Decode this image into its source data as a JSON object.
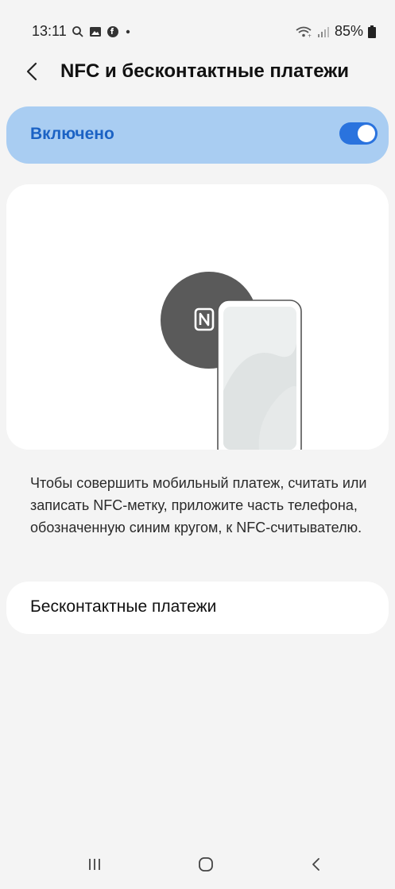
{
  "status_bar": {
    "time": "13:11",
    "battery": "85%",
    "left_icons": [
      "search-icon",
      "gallery-icon",
      "messenger-icon",
      "dot-icon"
    ],
    "right_icons": [
      "wifi-icon",
      "signal-icon",
      "battery-icon"
    ]
  },
  "header": {
    "title": "NFC и бесконтактные платежи"
  },
  "toggle": {
    "label": "Включено",
    "state": "on",
    "accent_color": "#2a73de",
    "background_color": "#a9cdf2"
  },
  "illustration": {
    "icon": "nfc-icon"
  },
  "description": "Чтобы совершить мобильный платеж, считать или записать NFC-метку, приложите часть телефона, обозначенную синим кругом, к NFC-считывателю.",
  "contactless": {
    "label": "Бесконтактные платежи"
  },
  "navbar": {
    "items": [
      "recent-apps-icon",
      "home-icon",
      "back-icon"
    ]
  }
}
